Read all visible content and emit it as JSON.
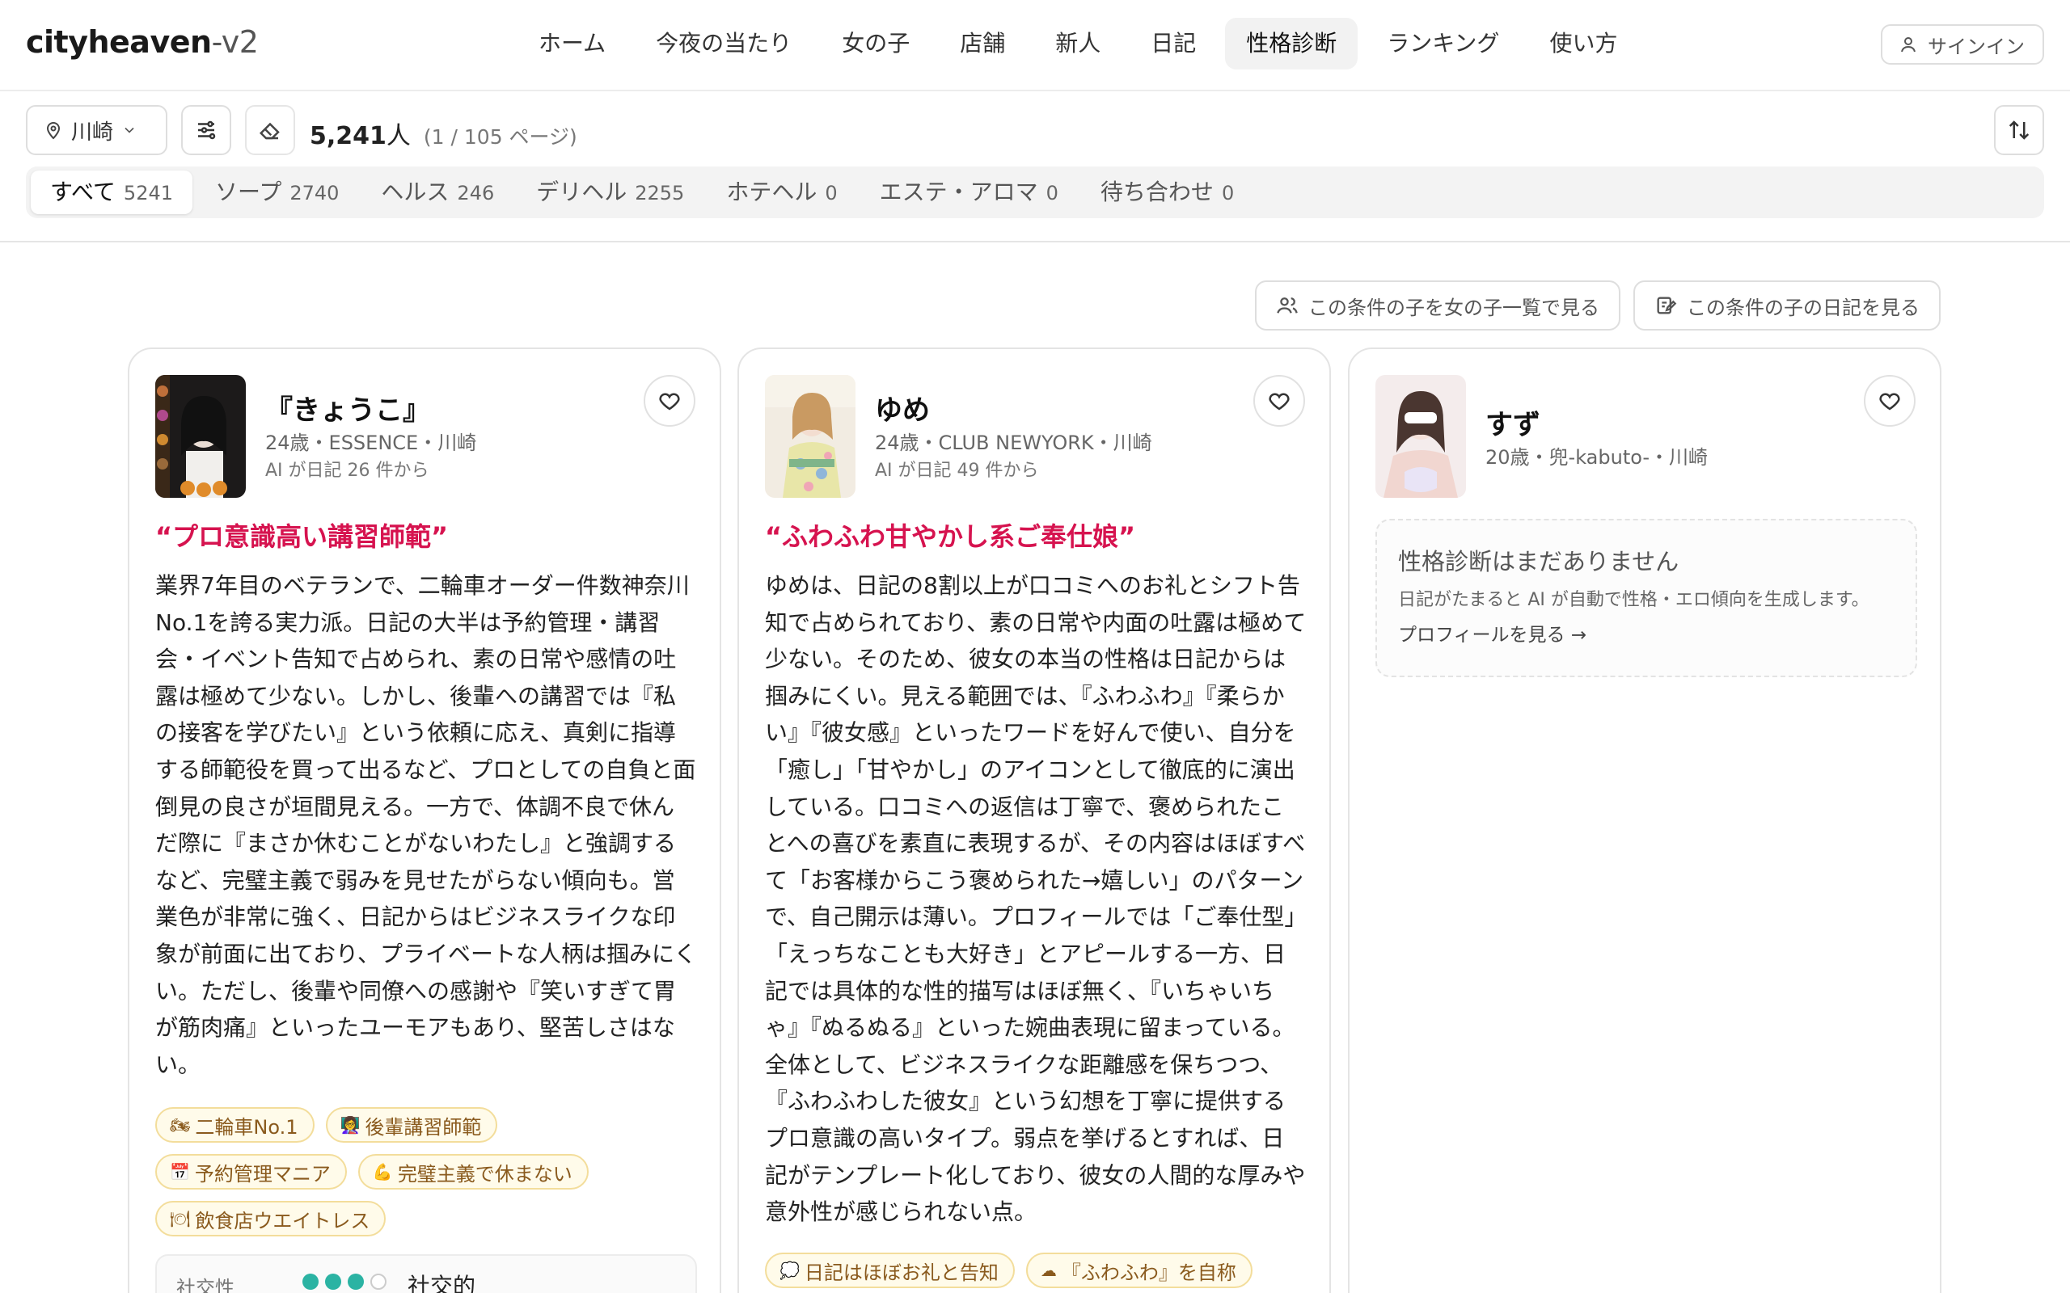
{
  "app": {
    "logo_main": "cityheaven",
    "logo_suffix": "-v2"
  },
  "nav": {
    "items": [
      "ホーム",
      "今夜の当たり",
      "女の子",
      "店舗",
      "新人",
      "日記",
      "性格診断",
      "ランキング",
      "使い方"
    ],
    "active": "性格診断",
    "signin_label": "サインイン"
  },
  "filters": {
    "location": "川崎",
    "count": "5,241",
    "count_unit": "人",
    "page_info": "(1 / 105 ページ)",
    "categories": [
      {
        "label": "すべて",
        "count": "5241",
        "active": true
      },
      {
        "label": "ソープ",
        "count": "2740"
      },
      {
        "label": "ヘルス",
        "count": "246"
      },
      {
        "label": "デリヘル",
        "count": "2255"
      },
      {
        "label": "ホテヘル",
        "count": "0"
      },
      {
        "label": "エステ・アロマ",
        "count": "0"
      },
      {
        "label": "待ち合わせ",
        "count": "0"
      }
    ]
  },
  "actions": {
    "girls_list": "この条件の子を女の子一覧で見る",
    "diary_list": "この条件の子の日記を見る"
  },
  "cards": [
    {
      "name": "『きょうこ』",
      "meta": "24歳・ESSENCE・川崎",
      "ai_note": "AI が日記 26 件から",
      "tagline": "“プロ意識高い講習師範”",
      "description": "業界7年目のベテランで、二輪車オーダー件数神奈川No.1を誇る実力派。日記の大半は予約管理・講習会・イベント告知で占められ、素の日常や感情の吐露は極めて少ない。しかし、後輩への講習では『私の接客を学びたい』という依頼に応え、真剣に指導する師範役を買って出るなど、プロとしての自負と面倒見の良さが垣間見える。一方で、体調不良で休んだ際に『まさか休むことがないわたし』と強調するなど、完璧主義で弱みを見せたがらない傾向も。営業色が非常に強く、日記からはビジネスライクな印象が前面に出ており、プライベートな人柄は掴みにくい。ただし、後輩や同僚への感謝や『笑いすぎて胃が筋肉痛』といったユーモアもあり、堅苦しさはない。",
      "tags": [
        {
          "icon": "🏍",
          "label": "二輪車No.1"
        },
        {
          "icon": "👩‍🏫",
          "label": "後輩講習師範"
        },
        {
          "icon": "📅",
          "label": "予約管理マニア"
        },
        {
          "icon": "💪",
          "label": "完璧主義で休まない"
        },
        {
          "icon": "🍽",
          "label": "飲食店ウエイトレス"
        }
      ],
      "trait": {
        "label": "社交性",
        "value": "社交的",
        "level": 0.75
      }
    },
    {
      "name": "ゆめ",
      "meta": "24歳・CLUB NEWYORK・川崎",
      "ai_note": "AI が日記 49 件から",
      "tagline": "“ふわふわ甘やかし系ご奉仕娘”",
      "description": "ゆめは、日記の8割以上が口コミへのお礼とシフト告知で占められており、素の日常や内面の吐露は極めて少ない。そのため、彼女の本当の性格は日記からは掴みにくい。見える範囲では、『ふわふわ』『柔らかい』『彼女感』といったワードを好んで使い、自分を「癒し」「甘やかし」のアイコンとして徹底的に演出している。口コミへの返信は丁寧で、褒められたことへの喜びを素直に表現するが、その内容はほぼすべて「お客様からこう褒められた→嬉しい」のパターンで、自己開示は薄い。プロフィールでは「ご奉仕型」「えっちなことも大好き」とアピールする一方、日記では具体的な性的描写はほぼ無く、『いちゃいちゃ』『ぬるぬる』といった婉曲表現に留まっている。全体として、ビジネスライクな距離感を保ちつつ、『ふわふわした彼女』という幻想を丁寧に提供するプロ意識の高いタイプ。弱点を挙げるとすれば、日記がテンプレート化しており、彼女の人間的な厚みや意外性が感じられない点。",
      "tags": [
        {
          "icon": "💭",
          "label": "日記はほぼお礼と告知"
        },
        {
          "icon": "☁",
          "label": "『ふわふわ』を自称"
        }
      ]
    },
    {
      "name": "すず",
      "meta": "20歳・兜-kabuto-・川崎",
      "empty_title": "性格診断はまだありません",
      "empty_desc": "日記がたまると AI が自動で性格・エロ傾向を生成します。",
      "empty_link": "プロフィールを見る →"
    }
  ]
}
